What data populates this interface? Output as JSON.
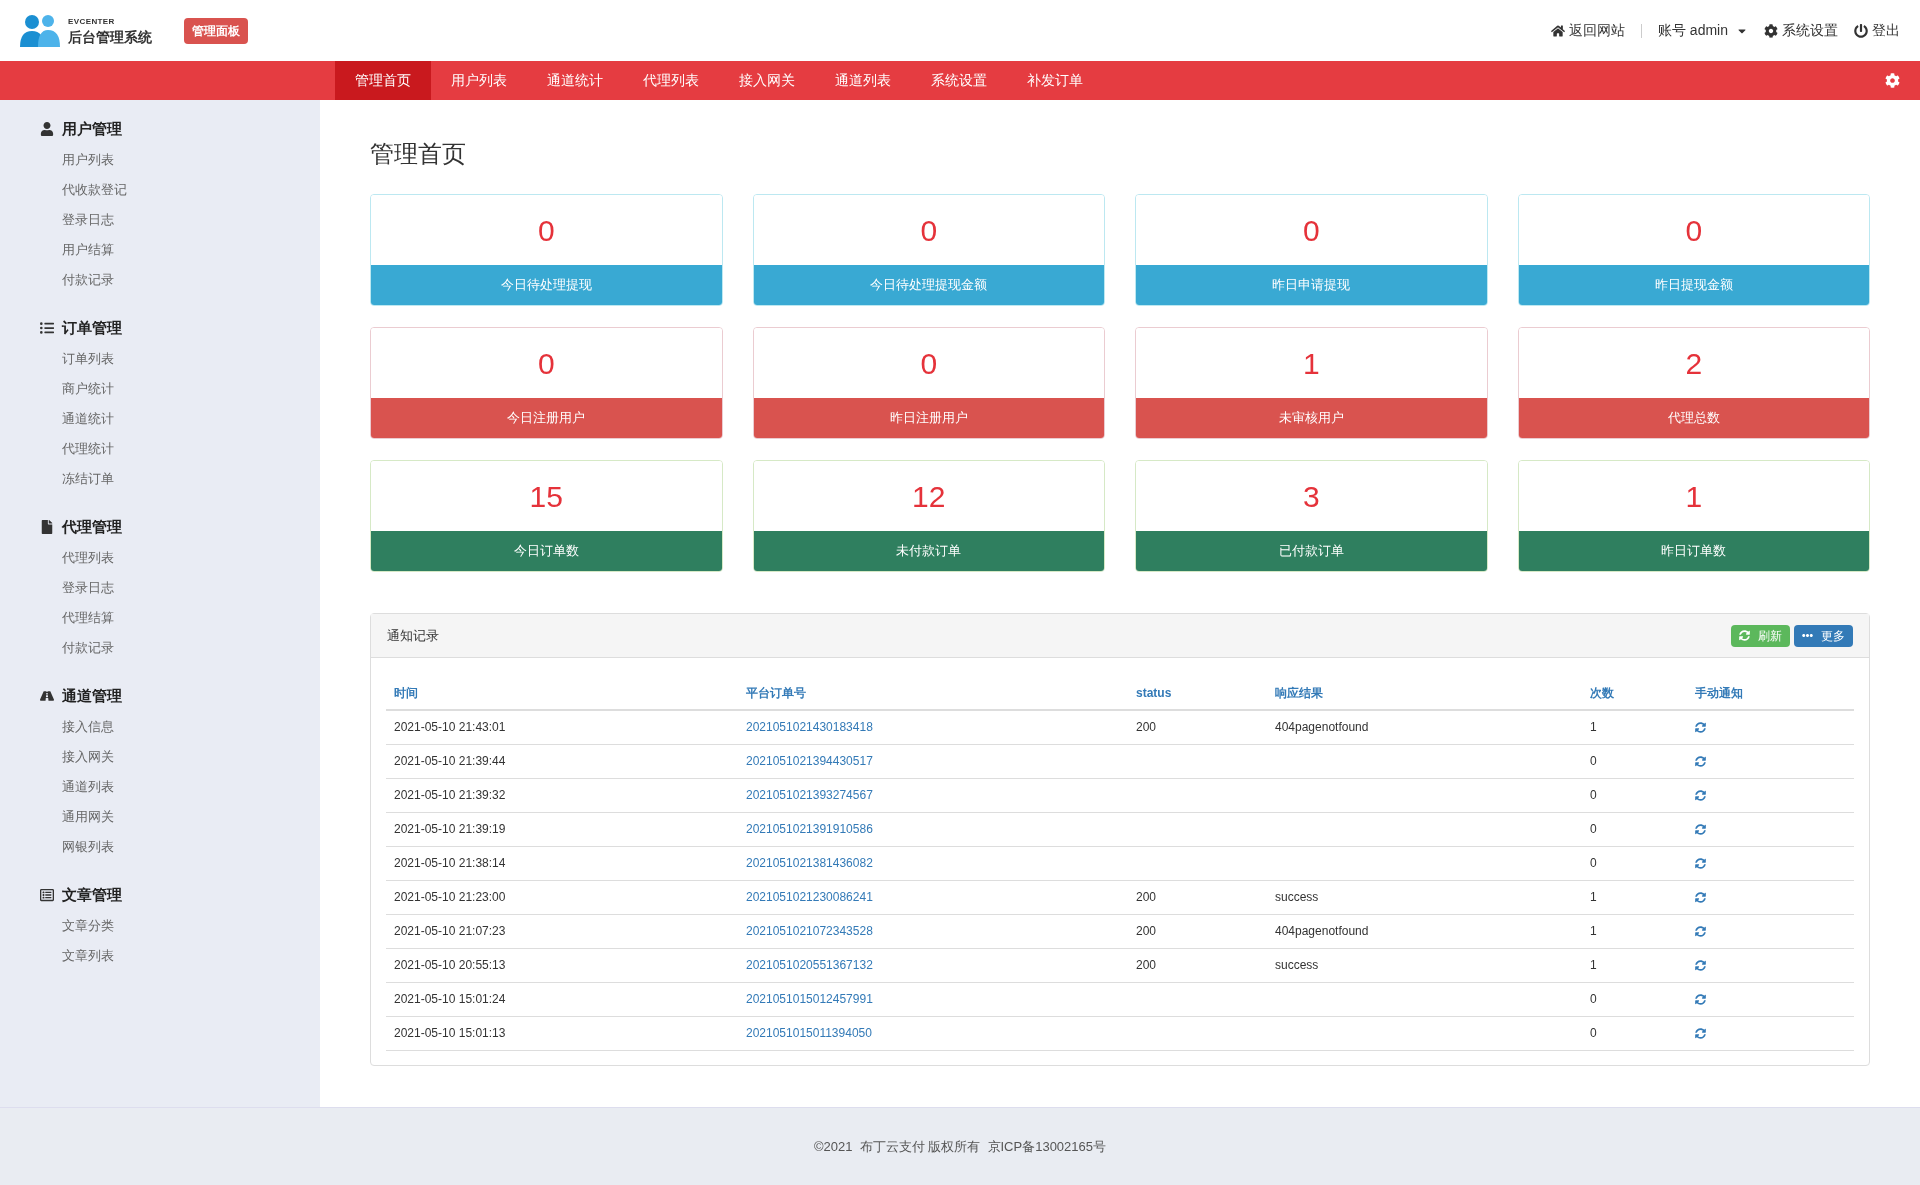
{
  "header": {
    "logo_small": "EVCENTER",
    "logo_title": "后台管理系统",
    "badge": "管理面板",
    "links": [
      {
        "kind": "home",
        "label": "返回网站"
      },
      {
        "kind": "account",
        "label": "账号 admin"
      },
      {
        "kind": "settings",
        "label": "系统设置"
      },
      {
        "kind": "logout",
        "label": "登出"
      }
    ]
  },
  "nav": [
    {
      "label": "管理首页",
      "selected": true
    },
    {
      "label": "用户列表",
      "selected": false
    },
    {
      "label": "通道统计",
      "selected": false
    },
    {
      "label": "代理列表",
      "selected": false
    },
    {
      "label": "接入网关",
      "selected": false
    },
    {
      "label": "通道列表",
      "selected": false
    },
    {
      "label": "系统设置",
      "selected": false
    },
    {
      "label": "补发订单",
      "selected": false
    }
  ],
  "sidebar": [
    {
      "title": "用户管理",
      "items": [
        "用户列表",
        "代收款登记",
        "登录日志",
        "用户结算",
        "付款记录"
      ]
    },
    {
      "title": "订单管理",
      "items": [
        "订单列表",
        "商户统计",
        "通道统计",
        "代理统计",
        "冻结订单"
      ]
    },
    {
      "title": "代理管理",
      "items": [
        "代理列表",
        "登录日志",
        "代理结算",
        "付款记录"
      ]
    },
    {
      "title": "通道管理",
      "items": [
        "接入信息",
        "接入网关",
        "通道列表",
        "通用网关",
        "网银列表"
      ]
    },
    {
      "title": "文章管理",
      "items": [
        "文章分类",
        "文章列表"
      ]
    }
  ],
  "page_title": "管理首页",
  "cards": [
    {
      "kind": "info",
      "value": "0",
      "label": "今日待处理提现"
    },
    {
      "kind": "info",
      "value": "0",
      "label": "今日待处理提现金额"
    },
    {
      "kind": "info",
      "value": "0",
      "label": "昨日申请提现"
    },
    {
      "kind": "info",
      "value": "0",
      "label": "昨日提现金额"
    },
    {
      "kind": "danger",
      "value": "0",
      "label": "今日注册用户"
    },
    {
      "kind": "danger",
      "value": "0",
      "label": "昨日注册用户"
    },
    {
      "kind": "danger",
      "value": "1",
      "label": "未审核用户"
    },
    {
      "kind": "danger",
      "value": "2",
      "label": "代理总数"
    },
    {
      "kind": "success",
      "value": "15",
      "label": "今日订单数"
    },
    {
      "kind": "success",
      "value": "12",
      "label": "未付款订单"
    },
    {
      "kind": "success",
      "value": "3",
      "label": "已付款订单"
    },
    {
      "kind": "success",
      "value": "1",
      "label": "昨日订单数"
    }
  ],
  "panel": {
    "title": "通知记录",
    "buttons": [
      {
        "kind": "refresh",
        "label": "刷新"
      },
      {
        "kind": "more",
        "label": "更多"
      }
    ],
    "columns": [
      "时间",
      "平台订单号",
      "status",
      "响应结果",
      "次数",
      "手动通知"
    ],
    "rows": [
      [
        "2021-05-10 21:43:01",
        "2021051021430183418",
        "200",
        "404pagenotfound",
        "1"
      ],
      [
        "2021-05-10 21:39:44",
        "2021051021394430517",
        "",
        "",
        "0"
      ],
      [
        "2021-05-10 21:39:32",
        "2021051021393274567",
        "",
        "",
        "0"
      ],
      [
        "2021-05-10 21:39:19",
        "2021051021391910586",
        "",
        "",
        "0"
      ],
      [
        "2021-05-10 21:38:14",
        "2021051021381436082",
        "",
        "",
        "0"
      ],
      [
        "2021-05-10 21:23:00",
        "2021051021230086241",
        "200",
        "success",
        "1"
      ],
      [
        "2021-05-10 21:07:23",
        "2021051021072343528",
        "200",
        "404pagenotfound",
        "1"
      ],
      [
        "2021-05-10 20:55:13",
        "2021051020551367132",
        "200",
        "success",
        "1"
      ],
      [
        "2021-05-10 15:01:24",
        "2021051015012457991",
        "",
        "",
        "0"
      ],
      [
        "2021-05-10 15:01:13",
        "2021051015011394050",
        "",
        "",
        "0"
      ]
    ]
  },
  "footer": "©2021  布丁云支付 版权所有  京ICP备13002165号"
}
